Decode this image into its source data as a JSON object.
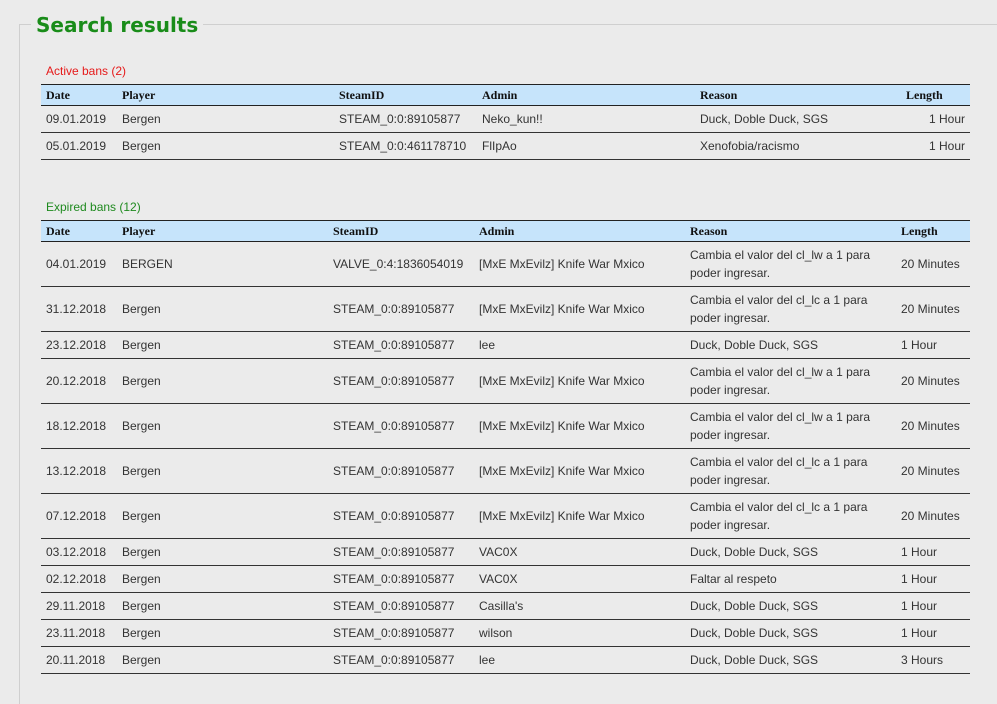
{
  "title": "Search results",
  "active": {
    "label": "Active bans (2)",
    "headers": {
      "date": "Date",
      "player": "Player",
      "steamid": "SteamID",
      "admin": "Admin",
      "reason": "Reason",
      "length": "Length"
    },
    "rows": [
      {
        "date": "09.01.2019",
        "player": "Bergen",
        "steamid": "STEAM_0:0:89105877",
        "admin": "Neko_kun!!",
        "reason": "Duck, Doble Duck, SGS",
        "length": "1 Hour"
      },
      {
        "date": "05.01.2019",
        "player": "Bergen",
        "steamid": "STEAM_0:0:461178710",
        "admin": "FlIpAo",
        "reason": "Xenofobia/racismo",
        "length": "1 Hour"
      }
    ]
  },
  "expired": {
    "label": "Expired bans (12)",
    "headers": {
      "date": "Date",
      "player": "Player",
      "steamid": "SteamID",
      "admin": "Admin",
      "reason": "Reason",
      "length": "Length"
    },
    "rows": [
      {
        "date": "04.01.2019",
        "player": "BERGEN",
        "steamid": "VALVE_0:4:1836054019",
        "admin": "[MxE MxEvilz] Knife War Mxico",
        "reason": "Cambia el valor del cl_lw a 1 para poder ingresar.",
        "length": "20 Minutes"
      },
      {
        "date": "31.12.2018",
        "player": "Bergen",
        "steamid": "STEAM_0:0:89105877",
        "admin": "[MxE MxEvilz] Knife War Mxico",
        "reason": "Cambia el valor del cl_lc a 1 para poder ingresar.",
        "length": "20 Minutes"
      },
      {
        "date": "23.12.2018",
        "player": "Bergen",
        "steamid": "STEAM_0:0:89105877",
        "admin": "lee",
        "reason": "Duck, Doble Duck, SGS",
        "length": "1 Hour"
      },
      {
        "date": "20.12.2018",
        "player": "Bergen",
        "steamid": "STEAM_0:0:89105877",
        "admin": "[MxE MxEvilz] Knife War Mxico",
        "reason": "Cambia el valor del cl_lw a 1 para poder ingresar.",
        "length": "20 Minutes"
      },
      {
        "date": "18.12.2018",
        "player": "Bergen",
        "steamid": "STEAM_0:0:89105877",
        "admin": "[MxE MxEvilz] Knife War Mxico",
        "reason": "Cambia el valor del cl_lw a 1 para poder ingresar.",
        "length": "20 Minutes"
      },
      {
        "date": "13.12.2018",
        "player": "Bergen",
        "steamid": "STEAM_0:0:89105877",
        "admin": "[MxE MxEvilz] Knife War Mxico",
        "reason": "Cambia el valor del cl_lc a 1 para poder ingresar.",
        "length": "20 Minutes"
      },
      {
        "date": "07.12.2018",
        "player": "Bergen",
        "steamid": "STEAM_0:0:89105877",
        "admin": "[MxE MxEvilz] Knife War Mxico",
        "reason": "Cambia el valor del cl_lc a 1 para poder ingresar.",
        "length": "20 Minutes"
      },
      {
        "date": "03.12.2018",
        "player": "Bergen",
        "steamid": "STEAM_0:0:89105877",
        "admin": "VAC0X",
        "reason": "Duck, Doble Duck, SGS",
        "length": "1 Hour"
      },
      {
        "date": "02.12.2018",
        "player": "Bergen",
        "steamid": "STEAM_0:0:89105877",
        "admin": "VAC0X",
        "reason": "Faltar al respeto",
        "length": "1 Hour"
      },
      {
        "date": "29.11.2018",
        "player": "Bergen",
        "steamid": "STEAM_0:0:89105877",
        "admin": "Casilla's",
        "reason": "Duck, Doble Duck, SGS",
        "length": "1 Hour"
      },
      {
        "date": "23.11.2018",
        "player": "Bergen",
        "steamid": "STEAM_0:0:89105877",
        "admin": "wilson",
        "reason": "Duck, Doble Duck, SGS",
        "length": "1 Hour"
      },
      {
        "date": "20.11.2018",
        "player": "Bergen",
        "steamid": "STEAM_0:0:89105877",
        "admin": "lee",
        "reason": "Duck, Doble Duck, SGS",
        "length": "3 Hours"
      }
    ]
  }
}
